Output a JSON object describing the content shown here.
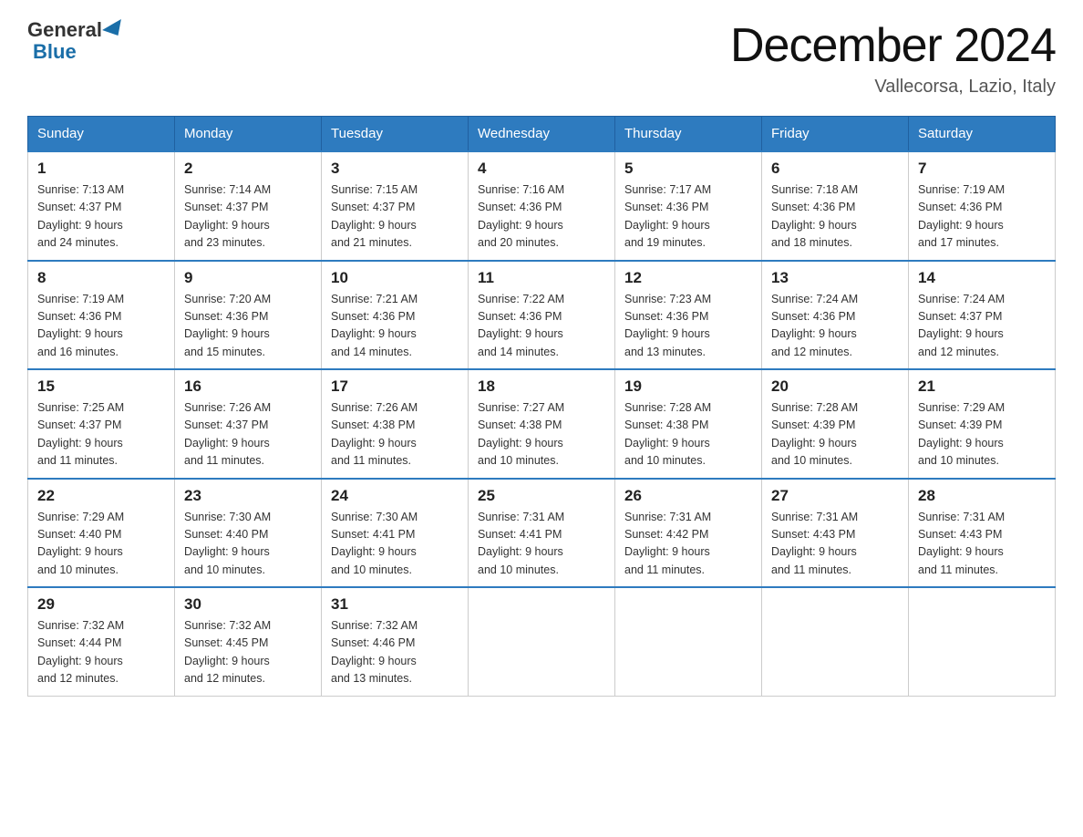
{
  "header": {
    "logo_general": "General",
    "logo_blue": "Blue",
    "month_title": "December 2024",
    "location": "Vallecorsa, Lazio, Italy"
  },
  "days_of_week": [
    "Sunday",
    "Monday",
    "Tuesday",
    "Wednesday",
    "Thursday",
    "Friday",
    "Saturday"
  ],
  "weeks": [
    [
      {
        "day": "1",
        "sunrise": "7:13 AM",
        "sunset": "4:37 PM",
        "daylight": "9 hours and 24 minutes."
      },
      {
        "day": "2",
        "sunrise": "7:14 AM",
        "sunset": "4:37 PM",
        "daylight": "9 hours and 23 minutes."
      },
      {
        "day": "3",
        "sunrise": "7:15 AM",
        "sunset": "4:37 PM",
        "daylight": "9 hours and 21 minutes."
      },
      {
        "day": "4",
        "sunrise": "7:16 AM",
        "sunset": "4:36 PM",
        "daylight": "9 hours and 20 minutes."
      },
      {
        "day": "5",
        "sunrise": "7:17 AM",
        "sunset": "4:36 PM",
        "daylight": "9 hours and 19 minutes."
      },
      {
        "day": "6",
        "sunrise": "7:18 AM",
        "sunset": "4:36 PM",
        "daylight": "9 hours and 18 minutes."
      },
      {
        "day": "7",
        "sunrise": "7:19 AM",
        "sunset": "4:36 PM",
        "daylight": "9 hours and 17 minutes."
      }
    ],
    [
      {
        "day": "8",
        "sunrise": "7:19 AM",
        "sunset": "4:36 PM",
        "daylight": "9 hours and 16 minutes."
      },
      {
        "day": "9",
        "sunrise": "7:20 AM",
        "sunset": "4:36 PM",
        "daylight": "9 hours and 15 minutes."
      },
      {
        "day": "10",
        "sunrise": "7:21 AM",
        "sunset": "4:36 PM",
        "daylight": "9 hours and 14 minutes."
      },
      {
        "day": "11",
        "sunrise": "7:22 AM",
        "sunset": "4:36 PM",
        "daylight": "9 hours and 14 minutes."
      },
      {
        "day": "12",
        "sunrise": "7:23 AM",
        "sunset": "4:36 PM",
        "daylight": "9 hours and 13 minutes."
      },
      {
        "day": "13",
        "sunrise": "7:24 AM",
        "sunset": "4:36 PM",
        "daylight": "9 hours and 12 minutes."
      },
      {
        "day": "14",
        "sunrise": "7:24 AM",
        "sunset": "4:37 PM",
        "daylight": "9 hours and 12 minutes."
      }
    ],
    [
      {
        "day": "15",
        "sunrise": "7:25 AM",
        "sunset": "4:37 PM",
        "daylight": "9 hours and 11 minutes."
      },
      {
        "day": "16",
        "sunrise": "7:26 AM",
        "sunset": "4:37 PM",
        "daylight": "9 hours and 11 minutes."
      },
      {
        "day": "17",
        "sunrise": "7:26 AM",
        "sunset": "4:38 PM",
        "daylight": "9 hours and 11 minutes."
      },
      {
        "day": "18",
        "sunrise": "7:27 AM",
        "sunset": "4:38 PM",
        "daylight": "9 hours and 10 minutes."
      },
      {
        "day": "19",
        "sunrise": "7:28 AM",
        "sunset": "4:38 PM",
        "daylight": "9 hours and 10 minutes."
      },
      {
        "day": "20",
        "sunrise": "7:28 AM",
        "sunset": "4:39 PM",
        "daylight": "9 hours and 10 minutes."
      },
      {
        "day": "21",
        "sunrise": "7:29 AM",
        "sunset": "4:39 PM",
        "daylight": "9 hours and 10 minutes."
      }
    ],
    [
      {
        "day": "22",
        "sunrise": "7:29 AM",
        "sunset": "4:40 PM",
        "daylight": "9 hours and 10 minutes."
      },
      {
        "day": "23",
        "sunrise": "7:30 AM",
        "sunset": "4:40 PM",
        "daylight": "9 hours and 10 minutes."
      },
      {
        "day": "24",
        "sunrise": "7:30 AM",
        "sunset": "4:41 PM",
        "daylight": "9 hours and 10 minutes."
      },
      {
        "day": "25",
        "sunrise": "7:31 AM",
        "sunset": "4:41 PM",
        "daylight": "9 hours and 10 minutes."
      },
      {
        "day": "26",
        "sunrise": "7:31 AM",
        "sunset": "4:42 PM",
        "daylight": "9 hours and 11 minutes."
      },
      {
        "day": "27",
        "sunrise": "7:31 AM",
        "sunset": "4:43 PM",
        "daylight": "9 hours and 11 minutes."
      },
      {
        "day": "28",
        "sunrise": "7:31 AM",
        "sunset": "4:43 PM",
        "daylight": "9 hours and 11 minutes."
      }
    ],
    [
      {
        "day": "29",
        "sunrise": "7:32 AM",
        "sunset": "4:44 PM",
        "daylight": "9 hours and 12 minutes."
      },
      {
        "day": "30",
        "sunrise": "7:32 AM",
        "sunset": "4:45 PM",
        "daylight": "9 hours and 12 minutes."
      },
      {
        "day": "31",
        "sunrise": "7:32 AM",
        "sunset": "4:46 PM",
        "daylight": "9 hours and 13 minutes."
      },
      null,
      null,
      null,
      null
    ]
  ],
  "labels": {
    "sunrise": "Sunrise:",
    "sunset": "Sunset:",
    "daylight": "Daylight:"
  }
}
